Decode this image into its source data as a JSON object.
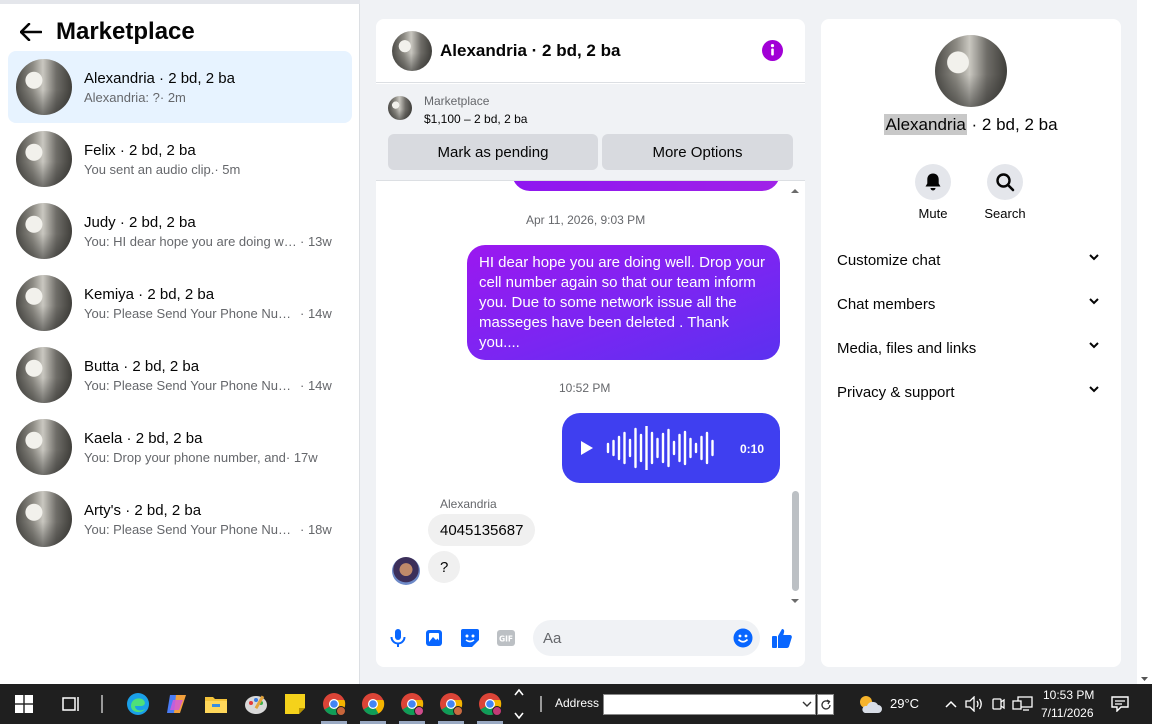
{
  "left": {
    "title": "Marketplace",
    "conversations": [
      {
        "name": "Alexandria · 2 bd, 2 ba",
        "msg": "Alexandria: ?",
        "time": " · 2m"
      },
      {
        "name": "Felix · 2 bd, 2 ba",
        "msg": "You sent an audio clip.",
        "time": " · 5m"
      },
      {
        "name": "Judy · 2 bd, 2 ba",
        "msg": "You: HI dear hope you are doing well.",
        "time": " · 13w"
      },
      {
        "name": "Kemiya · 2 bd, 2 ba",
        "msg": "You: Please Send Your Phone Number",
        "time": " · 14w"
      },
      {
        "name": "Butta · 2 bd, 2 ba",
        "msg": "You: Please Send Your Phone Number",
        "time": " · 14w"
      },
      {
        "name": "Kaela · 2 bd, 2 ba",
        "msg": "You: Drop your phone number, and",
        "time": " · 17w"
      },
      {
        "name": "Arty's · 2 bd, 2 ba",
        "msg": "You: Please Send Your Phone Number",
        "time": " · 18w"
      }
    ]
  },
  "chat": {
    "title": "Alexandria · 2 bd, 2 ba",
    "marketplace_label": "Marketplace",
    "listing": "$1,100 – 2 bd, 2 ba",
    "mark_pending": "Mark as pending",
    "more_options": "More Options",
    "timestamp1": "Apr 11, 2026, 9:03 PM",
    "outgoing_text": "HI dear hope you are doing well.  Drop your cell number again so that our team inform you.  Due to some network issue all the masseges have been deleted . Thank you....",
    "timestamp2": "10:52 PM",
    "audio_duration": "0:10",
    "sender_name": "Alexandria",
    "incoming1": "4045135687",
    "incoming2": "?",
    "composer_placeholder": "Aa"
  },
  "right": {
    "name_first": "Alexandria",
    "name_rest": " · 2 bd, 2 ba",
    "mute": "Mute",
    "search": "Search",
    "sections": [
      "Customize chat",
      "Chat members",
      "Media, files and links",
      "Privacy & support"
    ]
  },
  "taskbar": {
    "address_label": "Address",
    "temperature": "29°C",
    "time": "10:53 PM",
    "date": "7/11/2026"
  },
  "colors": {
    "accent_blue": "#0866ff",
    "message_purple": "#8e16f0",
    "audio_blue": "#3f3ff0",
    "active_row": "#e7f3ff"
  },
  "icons": [
    "back-arrow-icon",
    "info-icon",
    "microphone-icon",
    "image-icon",
    "sticker-icon",
    "gif-icon",
    "emoji-icon",
    "thumbs-up-icon",
    "bell-icon",
    "search-icon",
    "chevron-down-icon",
    "play-icon"
  ]
}
